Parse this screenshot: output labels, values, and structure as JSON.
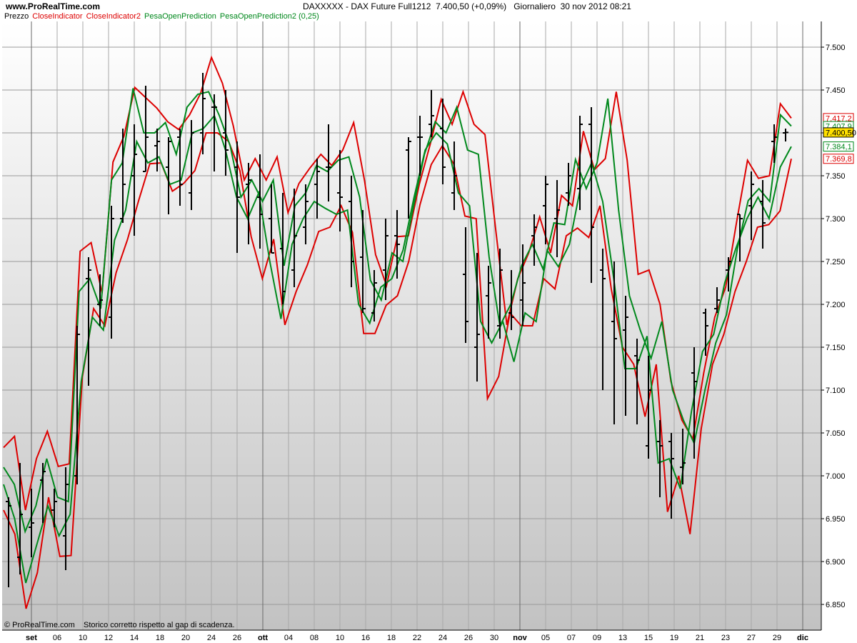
{
  "header": {
    "site": "www.ProRealTime.com",
    "instrument": "DAXXXXX - DAX Future Full1212",
    "price": "7.400,50 (+0,09%)",
    "timeframe": "Giornaliero",
    "datetime": "30 nov 2012 08:21"
  },
  "legend": [
    {
      "label": "Prezzo",
      "color": "#000000"
    },
    {
      "label": "CloseIndicator",
      "color": "#dd0000"
    },
    {
      "label": "CloseIndicator2",
      "color": "#dd0000"
    },
    {
      "label": "PesaOpenPrediction",
      "color": "#00881c"
    },
    {
      "label": "PesaOpenPrediction2 (0,25)",
      "color": "#00881c"
    }
  ],
  "footer": {
    "copyright": "© ProRealTime.com",
    "note": "Storico corretto rispetto al gap di scadenza."
  },
  "chart_data": {
    "type": "line",
    "ylim": [
      6820,
      7530
    ],
    "y_ticks": [
      "6.850",
      "6.900",
      "6.950",
      "7.000",
      "7.050",
      "7.100",
      "7.150",
      "7.200",
      "7.250",
      "7.300",
      "7.350",
      "7.400",
      "7.450",
      "7.500"
    ],
    "x_ticks": [
      "set",
      "06",
      "10",
      "12",
      "14",
      "18",
      "20",
      "24",
      "26",
      "ott",
      "04",
      "08",
      "10",
      "16",
      "18",
      "22",
      "24",
      "26",
      "30",
      "nov",
      "05",
      "07",
      "09",
      "13",
      "15",
      "19",
      "21",
      "23",
      "27",
      "29",
      "dic"
    ],
    "price_labels": [
      {
        "text": "7.417,2",
        "value": 7417.2,
        "color": "#dd0000",
        "highlight": false
      },
      {
        "text": "7.407,9",
        "value": 7407.9,
        "color": "#00881c",
        "highlight": false
      },
      {
        "text": "7.400,50",
        "value": 7400.5,
        "color": "#000000",
        "highlight": true
      },
      {
        "text": "7.384,1",
        "value": 7384.1,
        "color": "#00881c",
        "highlight": false
      },
      {
        "text": "7.369,8",
        "value": 7369.8,
        "color": "#dd0000",
        "highlight": false
      }
    ],
    "ohlc": [
      [
        6970,
        6975,
        6870,
        6965
      ],
      [
        6905,
        7015,
        6885,
        6955
      ],
      [
        6940,
        6985,
        6905,
        6945
      ],
      [
        6995,
        7015,
        6945,
        7005
      ],
      [
        6960,
        6985,
        6940,
        6970
      ],
      [
        6930,
        7010,
        6890,
        6990
      ],
      [
        7000,
        7175,
        6990,
        7165
      ],
      [
        7230,
        7255,
        7105,
        7240
      ],
      [
        7200,
        7235,
        7175,
        7205
      ],
      [
        7185,
        7315,
        7160,
        7300
      ],
      [
        7300,
        7405,
        7295,
        7340
      ],
      [
        7350,
        7410,
        7280,
        7375
      ],
      [
        7355,
        7455,
        7355,
        7395
      ],
      [
        7385,
        7405,
        7355,
        7390
      ],
      [
        7360,
        7395,
        7305,
        7390
      ],
      [
        7395,
        7405,
        7315,
        7340
      ],
      [
        7330,
        7415,
        7310,
        7400
      ],
      [
        7400,
        7470,
        7375,
        7440
      ],
      [
        7430,
        7445,
        7355,
        7430
      ],
      [
        7400,
        7450,
        7350,
        7380
      ],
      [
        7360,
        7390,
        7260,
        7325
      ],
      [
        7340,
        7365,
        7270,
        7345
      ],
      [
        7325,
        7375,
        7265,
        7305
      ],
      [
        7300,
        7340,
        7260,
        7260
      ],
      [
        7265,
        7330,
        7200,
        7215
      ],
      [
        7240,
        7335,
        7220,
        7280
      ],
      [
        7290,
        7340,
        7270,
        7320
      ],
      [
        7340,
        7370,
        7300,
        7355
      ],
      [
        7360,
        7410,
        7320,
        7360
      ],
      [
        7330,
        7380,
        7285,
        7325
      ],
      [
        7320,
        7350,
        7220,
        7250
      ],
      [
        7255,
        7310,
        7190,
        7195
      ],
      [
        7190,
        7240,
        7180,
        7225
      ],
      [
        7240,
        7300,
        7205,
        7280
      ],
      [
        7280,
        7310,
        7230,
        7270
      ],
      [
        7380,
        7395,
        7300,
        7390
      ],
      [
        7395,
        7420,
        7350,
        7395
      ],
      [
        7410,
        7450,
        7395,
        7420
      ],
      [
        7405,
        7440,
        7340,
        7360
      ],
      [
        7330,
        7390,
        7310,
        7350
      ],
      [
        7235,
        7290,
        7155,
        7180
      ],
      [
        7150,
        7260,
        7110,
        7165
      ],
      [
        7210,
        7245,
        7160,
        7225
      ],
      [
        7175,
        7265,
        7160,
        7240
      ],
      [
        7190,
        7240,
        7170,
        7185
      ],
      [
        7205,
        7270,
        7175,
        7225
      ],
      [
        7280,
        7305,
        7245,
        7290
      ],
      [
        7315,
        7350,
        7270,
        7340
      ],
      [
        7300,
        7345,
        7255,
        7310
      ],
      [
        7330,
        7365,
        7315,
        7350
      ],
      [
        7335,
        7420,
        7310,
        7410
      ],
      [
        7410,
        7430,
        7225,
        7290
      ],
      [
        7240,
        7265,
        7100,
        7230
      ],
      [
        7180,
        7250,
        7060,
        7160
      ],
      [
        7170,
        7210,
        7070,
        7185
      ],
      [
        7140,
        7160,
        7060,
        7135
      ],
      [
        7035,
        7140,
        7020,
        7100
      ],
      [
        7040,
        7065,
        6975,
        7035
      ],
      [
        7040,
        7050,
        6950,
        7020
      ],
      [
        7010,
        7055,
        6990,
        7015
      ],
      [
        7120,
        7150,
        7020,
        7110
      ],
      [
        7190,
        7195,
        7140,
        7175
      ],
      [
        7195,
        7220,
        7190,
        7205
      ],
      [
        7240,
        7255,
        7215,
        7250
      ],
      [
        7305,
        7305,
        7250,
        7300
      ],
      [
        7315,
        7355,
        7275,
        7340
      ],
      [
        7320,
        7345,
        7265,
        7295
      ],
      [
        7390,
        7410,
        7365,
        7395
      ],
      [
        7400,
        7405,
        7390,
        7400.5
      ]
    ],
    "series": [
      {
        "name": "CloseIndicator",
        "color": "#dd0000",
        "values": [
          7033,
          7046,
          6960,
          7020,
          7052,
          7011,
          7014,
          7262,
          7272,
          7213,
          7366,
          7396,
          7453,
          7441,
          7429,
          7413,
          7404,
          7421,
          7446,
          7488,
          7458,
          7408,
          7345,
          7370,
          7345,
          7372,
          7307,
          7341,
          7359,
          7375,
          7362,
          7380,
          7412,
          7344,
          7258,
          7222,
          7279,
          7280,
          7340,
          7387,
          7439,
          7410,
          7448,
          7410,
          7398,
          7285,
          7176,
          7230,
          7260,
          7302,
          7260,
          7327,
          7315,
          7402,
          7357,
          7370,
          7448,
          7368,
          7235,
          7240,
          7200,
          7110,
          7065,
          7043,
          7120,
          7185,
          7220,
          7296,
          7368,
          7347,
          7350,
          7434,
          7417.2
        ]
      },
      {
        "name": "CloseIndicator2",
        "color": "#dd0000",
        "values": [
          6960,
          6932,
          6845,
          6887,
          6975,
          6906,
          6907,
          7115,
          7195,
          7175,
          7237,
          7275,
          7321,
          7364,
          7365,
          7332,
          7341,
          7356,
          7400,
          7400,
          7390,
          7356,
          7279,
          7230,
          7276,
          7176,
          7215,
          7246,
          7285,
          7290,
          7315,
          7284,
          7166,
          7166,
          7199,
          7210,
          7250,
          7316,
          7363,
          7385,
          7364,
          7303,
          7300,
          7090,
          7116,
          7190,
          7175,
          7175,
          7230,
          7218,
          7280,
          7289,
          7278,
          7315,
          7218,
          7150,
          7130,
          7069,
          7130,
          6958,
          7000,
          6932,
          7055,
          7130,
          7165,
          7215,
          7250,
          7290,
          7293,
          7309,
          7369.8
        ]
      },
      {
        "name": "PesaOpenPrediction",
        "color": "#00881c",
        "values": [
          7010,
          6990,
          6935,
          6965,
          7020,
          6975,
          6970,
          7215,
          7230,
          7195,
          7345,
          7365,
          7452,
          7400,
          7400,
          7412,
          7375,
          7430,
          7445,
          7448,
          7420,
          7385,
          7325,
          7345,
          7320,
          7345,
          7245,
          7315,
          7330,
          7362,
          7355,
          7368,
          7372,
          7325,
          7228,
          7205,
          7260,
          7250,
          7315,
          7375,
          7413,
          7400,
          7430,
          7380,
          7375,
          7255,
          7175,
          7200,
          7245,
          7270,
          7241,
          7295,
          7293,
          7369,
          7335,
          7365,
          7440,
          7310,
          7210,
          7170,
          7137,
          7180,
          7100,
          7065,
          7038,
          7100,
          7155,
          7188,
          7265,
          7321,
          7335,
          7320,
          7421,
          7407.9
        ]
      },
      {
        "name": "PesaOpenPrediction2 (0,25)",
        "color": "#00881c",
        "values": [
          6990,
          6950,
          6875,
          6920,
          6965,
          6930,
          6955,
          7110,
          7185,
          7170,
          7275,
          7310,
          7390,
          7365,
          7372,
          7340,
          7345,
          7400,
          7405,
          7420,
          7380,
          7325,
          7300,
          7330,
          7250,
          7183,
          7270,
          7300,
          7320,
          7312,
          7305,
          7310,
          7200,
          7178,
          7220,
          7230,
          7263,
          7325,
          7380,
          7400,
          7387,
          7330,
          7315,
          7180,
          7155,
          7180,
          7133,
          7190,
          7180,
          7263,
          7244,
          7270,
          7336,
          7365,
          7320,
          7230,
          7125,
          7125,
          7163,
          7015,
          7020,
          6985,
          7075,
          7145,
          7165,
          7225,
          7265,
          7300,
          7325,
          7300,
          7360,
          7384.1
        ]
      }
    ]
  }
}
